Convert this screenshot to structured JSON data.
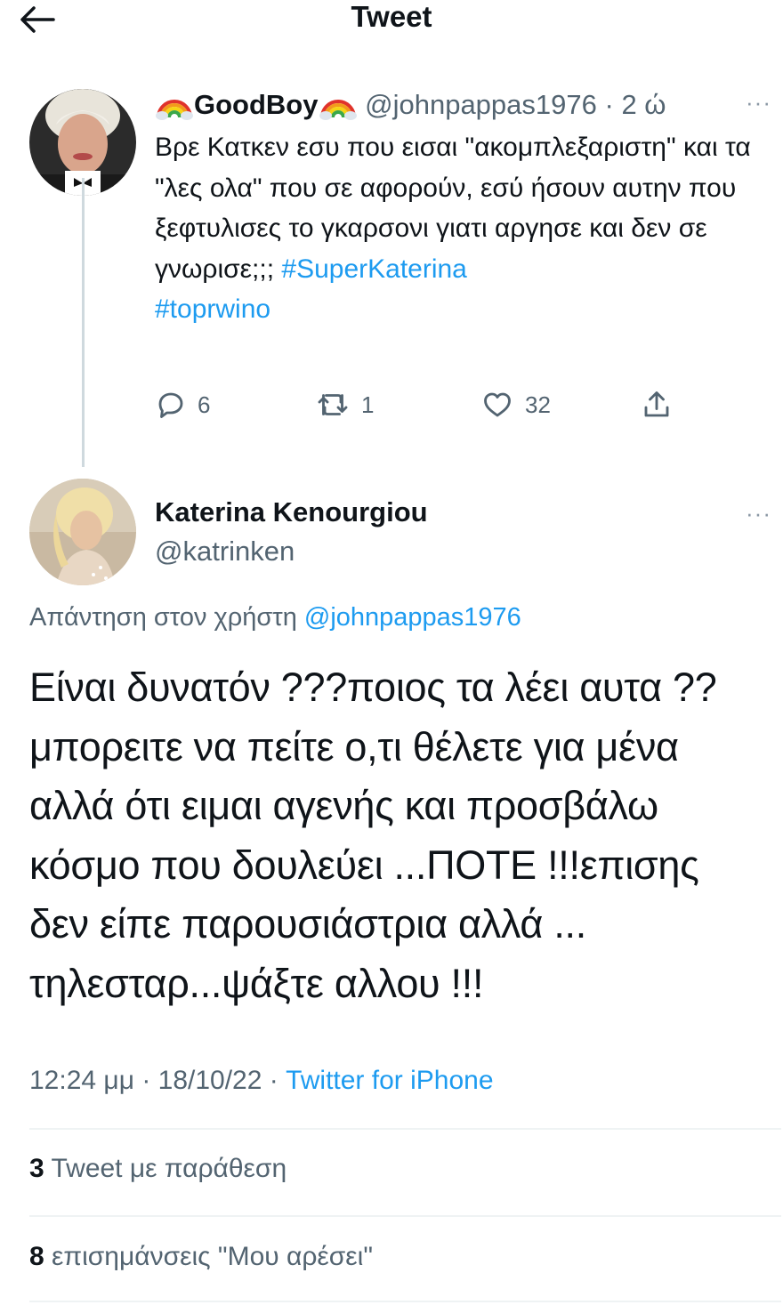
{
  "header": {
    "title": "Tweet"
  },
  "parent_tweet": {
    "display_name": "GoodBoy",
    "handle": "@johnpappas1976",
    "separator": " · ",
    "time": "2 ώ",
    "text": "Βρε Κατκεν εσυ που εισαι \"ακομπλεξαριστη\" και τα \"λες ολα\" που σε αφορούν, εσύ ήσουν αυτην που ξεφτυλισες το γκαρσονι γιατι αργησε και δεν σε γνωρισε;;; ",
    "hashtag_1": "#SuperKaterina",
    "hashtag_2": "#toprwino",
    "replies": "6",
    "retweets": "1",
    "likes": "32"
  },
  "main_tweet": {
    "display_name": "Katerina Kenourgiou",
    "handle": "@katrinken",
    "replying_prefix": "Απάντηση στον χρήστη ",
    "replying_to": "@johnpappas1976",
    "lines": [
      "Είναι δυνατόν ???ποιος τα λέει αυτα ??",
      "μπορειτε να πείτε ο,τι θέλετε για μένα",
      "αλλά ότι ειμαι αγενής και προσβάλω",
      "κόσμο που δουλεύει ...ΠΟΤΕ !!!επισης",
      "δεν είπε παρουσιάστρια αλλά ...",
      "τηλεσταρ...ψάξτε αλλου !!!"
    ],
    "timestamp": "12:24 μμ · 18/10/22 · ",
    "source": "Twitter for iPhone",
    "quote_count": "3",
    "quote_label": " Tweet με παράθεση",
    "like_count": "8",
    "like_label": " επισημάνσεις \"Μου αρέσει\""
  },
  "colors": {
    "accent": "#1d9bf0",
    "secondary_text": "#536471",
    "primary_text": "#0f1419"
  },
  "icons": [
    "back-arrow-icon",
    "rainbow-emoji-icon",
    "more-options-icon",
    "reply-icon",
    "retweet-icon",
    "like-icon",
    "share-icon"
  ]
}
